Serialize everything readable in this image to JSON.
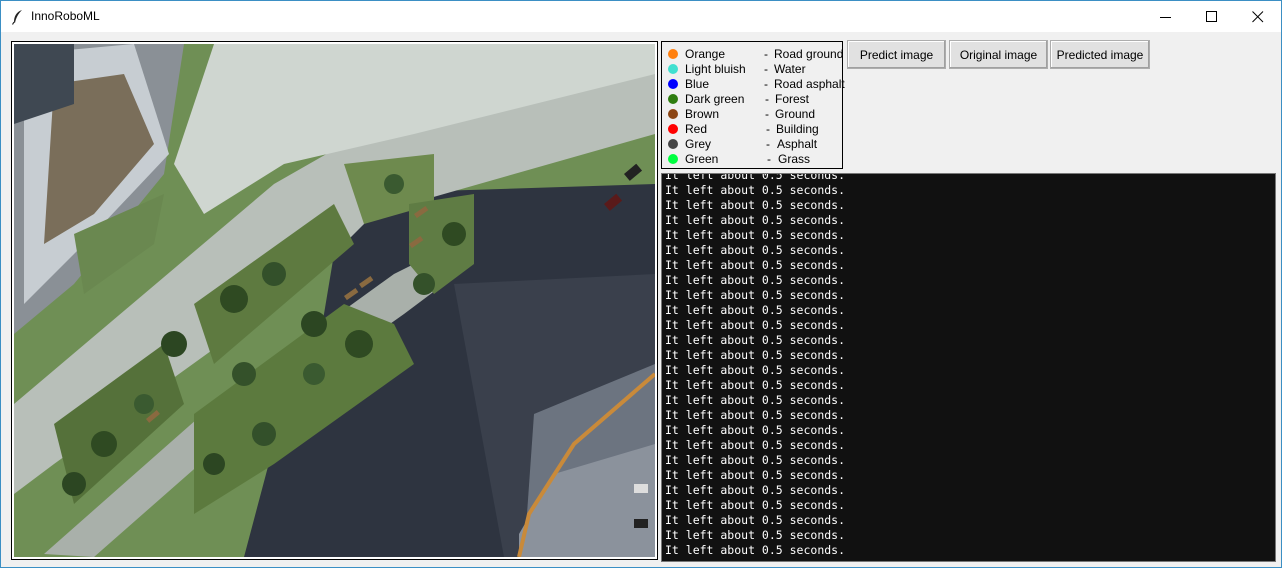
{
  "window": {
    "title": "InnoRoboML",
    "icon": "feather-icon",
    "controls": [
      "minimize-icon",
      "maximize-icon",
      "close-icon"
    ]
  },
  "image_panel": {
    "description_name": "aerial-photo"
  },
  "legend": {
    "items": [
      {
        "color_name": "Orange",
        "class": "Road ground",
        "color": "#ff7f0e"
      },
      {
        "color_name": "Light bluish",
        "class": "Water",
        "color": "#40e0d0"
      },
      {
        "color_name": "Blue",
        "class": "Road asphalt",
        "color": "#0000ff"
      },
      {
        "color_name": "Dark green",
        "class": "Forest",
        "color": "#2e7d0f"
      },
      {
        "color_name": "Brown",
        "class": "Ground",
        "color": "#8b4513"
      },
      {
        "color_name": "Red",
        "class": "Building",
        "color": "#ff0000"
      },
      {
        "color_name": "Grey",
        "class": "Asphalt",
        "color": "#444444"
      },
      {
        "color_name": "Green",
        "class": "Grass",
        "color": "#00ff40"
      }
    ],
    "separator": "-"
  },
  "buttons": {
    "predict": "Predict image",
    "original": "Original image",
    "predicted": "Predicted image"
  },
  "console": {
    "lines": [
      "It left about 0.5 seconds.",
      "It left about 0.5 seconds.",
      "It left about 0.5 seconds.",
      "It left about 0.5 seconds.",
      "It left about 0.5 seconds.",
      "It left about 0.5 seconds.",
      "It left about 0.5 seconds.",
      "It left about 0.5 seconds.",
      "It left about 0.5 seconds.",
      "It left about 0.5 seconds.",
      "It left about 0.5 seconds.",
      "It left about 0.5 seconds.",
      "It left about 0.5 seconds.",
      "It left about 0.5 seconds.",
      "It left about 0.5 seconds.",
      "It left about 0.5 seconds.",
      "It left about 0.5 seconds.",
      "It left about 0.5 seconds.",
      "It left about 0.5 seconds.",
      "It left about 0.5 seconds.",
      "It left about 0.5 seconds.",
      "It left about 0.5 seconds.",
      "It left about 0.5 seconds.",
      "It left about 0.5 seconds.",
      "It left about 0.5 seconds.",
      "It left about 0.5 seconds."
    ]
  }
}
